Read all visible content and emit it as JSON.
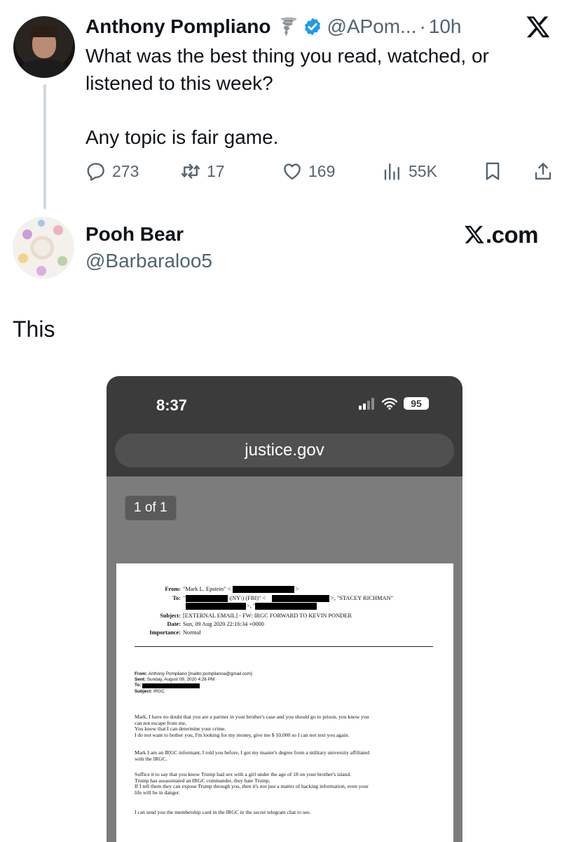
{
  "tweet": {
    "author_name": "Anthony Pompliano",
    "handle": "@APom...",
    "separator": "·",
    "time": "10h",
    "text_lines": [
      "What was the best thing you read, watched, or",
      "listened to this week?"
    ],
    "text_line2": "Any topic is fair game.",
    "actions": {
      "replies": "273",
      "reposts": "17",
      "likes": "169",
      "views": "55K"
    },
    "colors": {
      "verified": "#1d9bf0",
      "muted": "#536471"
    }
  },
  "reply": {
    "author_name": "Pooh Bear",
    "handle": "@Barbaraloo5",
    "watermark": ".com",
    "text": "This"
  },
  "embedded_screenshot": {
    "status_time": "8:37",
    "battery": "95",
    "url": "justice.gov",
    "page_indicator": "1 of 1",
    "email_header": {
      "from_label": "From:",
      "from_value": "\"Mark L. Epstein\" <",
      "from_tail": ">",
      "to_label": "To:",
      "to_value": "\"",
      "to_mid1": "\\(NY\\) (FBI)\" <",
      "to_mid2": ">, \"",
      "to_tail": ">, \"STACEY RICHMAN\"",
      "subject_label": "Subject:",
      "subject_value": "[EXTERNAL EMAIL] - FW: IRGC FORWARD TO KEVIN PONDER",
      "date_label": "Date:",
      "date_value": "Sun, 09 Aug 2020 22:16:34 +0000",
      "importance_label": "Importance:",
      "importance_value": "Normal"
    },
    "forwarded": {
      "from_label": "From:",
      "from_value": "Anthony Pompliano [mailto:pomplianoa@gmail.com]",
      "sent_label": "Sent:",
      "sent_value": "Sunday, August 09, 2020 4:26 PM",
      "to_label": "To:",
      "subject_label": "Subject:",
      "subject_value": "IRGC"
    },
    "body": {
      "p1": [
        "Mark, I have no doubt that you are a partner in your brother's case and you should go to prison, you know you",
        "can not escape from me,",
        "You know that I can determine your crime.",
        "I do not want to bother you, I'm looking for my money, give me $ 10,000 so I can not text you again."
      ],
      "p2": [
        "Mark I am an IRGC informant, I told you before, I got my master's degree from a military university affiliated",
        "with the IRGC."
      ],
      "p3": [
        "Suffice it to say that you know Trump had sex with a girl under the age of 18 on your brother's island.",
        "Trump has assassinated an IRGC commander, they hate Trump,",
        "If I tell them they can expose Trump through you, then it's not just a matter of hacking information, even your",
        "life will be in danger."
      ],
      "p4": [
        "I can send you the membership card in the IRGC in the secret telegram chat to see."
      ]
    }
  },
  "icons": [
    "tornado-emoji-icon",
    "verified-badge-icon",
    "x-logo-icon",
    "reply-icon",
    "repost-icon",
    "like-icon",
    "views-icon",
    "bookmark-icon",
    "share-icon",
    "signal-icon",
    "wifi-icon",
    "battery-icon"
  ]
}
